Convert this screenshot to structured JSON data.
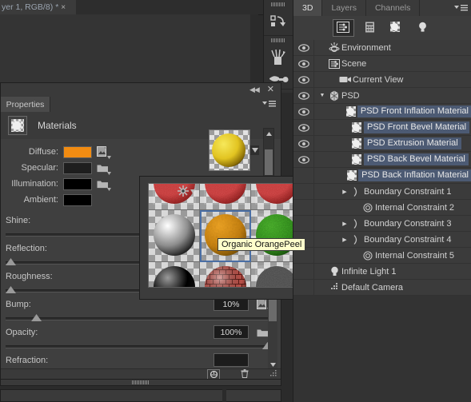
{
  "document_tab": {
    "title": "yer 1, RGB/8)",
    "modified_marker": "*",
    "close_glyph": "×"
  },
  "toolstrip": {
    "groups": [
      {
        "name": "history-brush-tool",
        "icon": "history-brush-icon"
      },
      {
        "name": "brush-tools",
        "icon": "brush-set-icon"
      },
      {
        "name": "gradient-tool",
        "icon": "gradient-tool-icon"
      }
    ]
  },
  "properties": {
    "tab_label": "Properties",
    "collapse_glyph": "◀◀",
    "close_glyph": "✕",
    "header_title": "Materials",
    "header_icon": "material-sphere-icon",
    "swatches": [
      {
        "label": "Diffuse:",
        "color": "#f28c12",
        "has_file_icon": true,
        "file_icon": "texture-image-icon"
      },
      {
        "label": "Specular:",
        "color": "#1e1e1e",
        "has_file_icon": true,
        "file_icon": "folder-icon"
      },
      {
        "label": "Illumination:",
        "color": "#000000",
        "has_file_icon": true,
        "file_icon": "folder-icon"
      },
      {
        "label": "Ambient:",
        "color": "#000000",
        "has_file_icon": false,
        "file_icon": ""
      }
    ],
    "sliders": [
      {
        "label": "Shine:",
        "value": "",
        "knob_pct": 0,
        "show_value": false,
        "show_knob": false,
        "file_icon": ""
      },
      {
        "label": "Reflection:",
        "value": "",
        "knob_pct": 0,
        "show_value": false,
        "show_knob": true,
        "file_icon": ""
      },
      {
        "label": "Roughness:",
        "value": "",
        "knob_pct": 0,
        "show_value": false,
        "show_knob": true,
        "file_icon": ""
      },
      {
        "label": "Bump:",
        "value": "10%",
        "knob_pct": 10,
        "show_value": true,
        "show_knob": true,
        "file_icon": "texture-image-icon"
      },
      {
        "label": "Opacity:",
        "value": "100%",
        "knob_pct": 100,
        "show_value": true,
        "show_knob": true,
        "file_icon": "folder-icon"
      },
      {
        "label": "Refraction:",
        "value": "",
        "knob_pct": 0,
        "show_value": true,
        "show_knob": false,
        "file_icon": ""
      }
    ],
    "preview_label": "material-sphere-preview",
    "footer": {
      "buttons": [
        {
          "name": "new-material-button",
          "icon": "sphere-add-icon"
        },
        {
          "name": "delete-button",
          "icon": "trash-icon"
        },
        {
          "name": "resize-grip",
          "icon": "resize-grip-icon"
        }
      ]
    }
  },
  "material_picker": {
    "tooltip": "Organic OrangePeel",
    "gear_icon": "gear-icon",
    "selected_index": 4,
    "swatches": [
      {
        "name": "red-glitter-material",
        "kind": "speckle",
        "c1": "#c03a3a",
        "c2": "#6a1414"
      },
      {
        "name": "red-glitter-material-2",
        "kind": "speckle",
        "c1": "#c03a3a",
        "c2": "#6a1414"
      },
      {
        "name": "red-glitter-material-3",
        "kind": "speckle",
        "c1": "#c03a3a",
        "c2": "#6a1414"
      },
      {
        "name": "white-glossy-material",
        "kind": "gloss",
        "c1": "#ffffff",
        "c2": "#8d8d8d"
      },
      {
        "name": "organic-orangepeel-material",
        "kind": "bumpy",
        "c1": "#f0a524",
        "c2": "#6e4a05"
      },
      {
        "name": "green-grass-material",
        "kind": "grass",
        "c1": "#3f9c25",
        "c2": "#0f3a06"
      },
      {
        "name": "black-glossy-material",
        "kind": "gloss",
        "c1": "#9a9a9a",
        "c2": "#000000"
      },
      {
        "name": "red-brick-material",
        "kind": "brick",
        "c1": "#b85048",
        "c2": "#5a1a15"
      },
      {
        "name": "black-speckle-material",
        "kind": "speckle",
        "c1": "#4a4a4a",
        "c2": "#000000"
      }
    ]
  },
  "panel_3d": {
    "tabs": [
      {
        "label": "3D",
        "active": true
      },
      {
        "label": "Layers",
        "active": false
      },
      {
        "label": "Channels",
        "active": false
      }
    ],
    "menu_icon": "panel-menu-icon",
    "filters": [
      {
        "name": "filter-scene-button",
        "icon": "scene-filter-icon",
        "active": true
      },
      {
        "name": "filter-meshes-button",
        "icon": "mesh-filter-icon",
        "active": false
      },
      {
        "name": "filter-materials-button",
        "icon": "material-filter-icon",
        "active": false
      },
      {
        "name": "filter-lights-button",
        "icon": "light-filter-icon",
        "active": false
      }
    ],
    "rows": [
      {
        "label": "Environment",
        "icon": "environment-icon",
        "indent": 0,
        "eye": true,
        "selected": false,
        "twisty": ""
      },
      {
        "label": "Scene",
        "icon": "scene-icon",
        "indent": 0,
        "eye": true,
        "selected": false,
        "twisty": ""
      },
      {
        "label": "Current View",
        "icon": "camera-icon",
        "indent": 1,
        "eye": true,
        "selected": false,
        "twisty": ""
      },
      {
        "label": "PSD",
        "icon": "mesh-icon",
        "indent": 0,
        "eye": true,
        "selected": false,
        "twisty": "▼"
      },
      {
        "label": "PSD Front Inflation Material",
        "icon": "material-icon",
        "indent": 2,
        "eye": true,
        "selected": true,
        "twisty": ""
      },
      {
        "label": "PSD Front Bevel Material",
        "icon": "material-icon",
        "indent": 2,
        "eye": true,
        "selected": true,
        "twisty": ""
      },
      {
        "label": "PSD Extrusion Material",
        "icon": "material-icon",
        "indent": 2,
        "eye": true,
        "selected": true,
        "twisty": ""
      },
      {
        "label": "PSD Back Bevel Material",
        "icon": "material-icon",
        "indent": 2,
        "eye": true,
        "selected": true,
        "twisty": ""
      },
      {
        "label": "PSD Back Inflation Material",
        "icon": "material-icon",
        "indent": 2,
        "eye": false,
        "selected": true,
        "twisty": ""
      },
      {
        "label": "Boundary Constraint 1",
        "icon": "boundary-constraint-icon",
        "indent": 2,
        "eye": false,
        "selected": false,
        "twisty": "▶"
      },
      {
        "label": "Internal Constraint 2",
        "icon": "internal-constraint-icon",
        "indent": 3,
        "eye": false,
        "selected": false,
        "twisty": ""
      },
      {
        "label": "Boundary Constraint 3",
        "icon": "boundary-constraint-icon",
        "indent": 2,
        "eye": false,
        "selected": false,
        "twisty": "▶"
      },
      {
        "label": "Boundary Constraint 4",
        "icon": "boundary-constraint-icon",
        "indent": 2,
        "eye": false,
        "selected": false,
        "twisty": "▶"
      },
      {
        "label": "Internal Constraint 5",
        "icon": "internal-constraint-icon",
        "indent": 3,
        "eye": false,
        "selected": false,
        "twisty": ""
      },
      {
        "label": "Infinite Light 1",
        "icon": "light-icon",
        "indent": 0,
        "eye": false,
        "selected": false,
        "twisty": ""
      },
      {
        "label": "Default Camera",
        "icon": "camera-small-icon",
        "indent": 0,
        "eye": false,
        "selected": false,
        "twisty": ""
      }
    ]
  },
  "colors": {
    "panel_bg": "#3f3f3f",
    "panel_header": "#3a3a3a",
    "selection_blue": "#4c5a73",
    "accent_orange": "#f28c12",
    "tooltip_bg": "#ffffcc"
  }
}
